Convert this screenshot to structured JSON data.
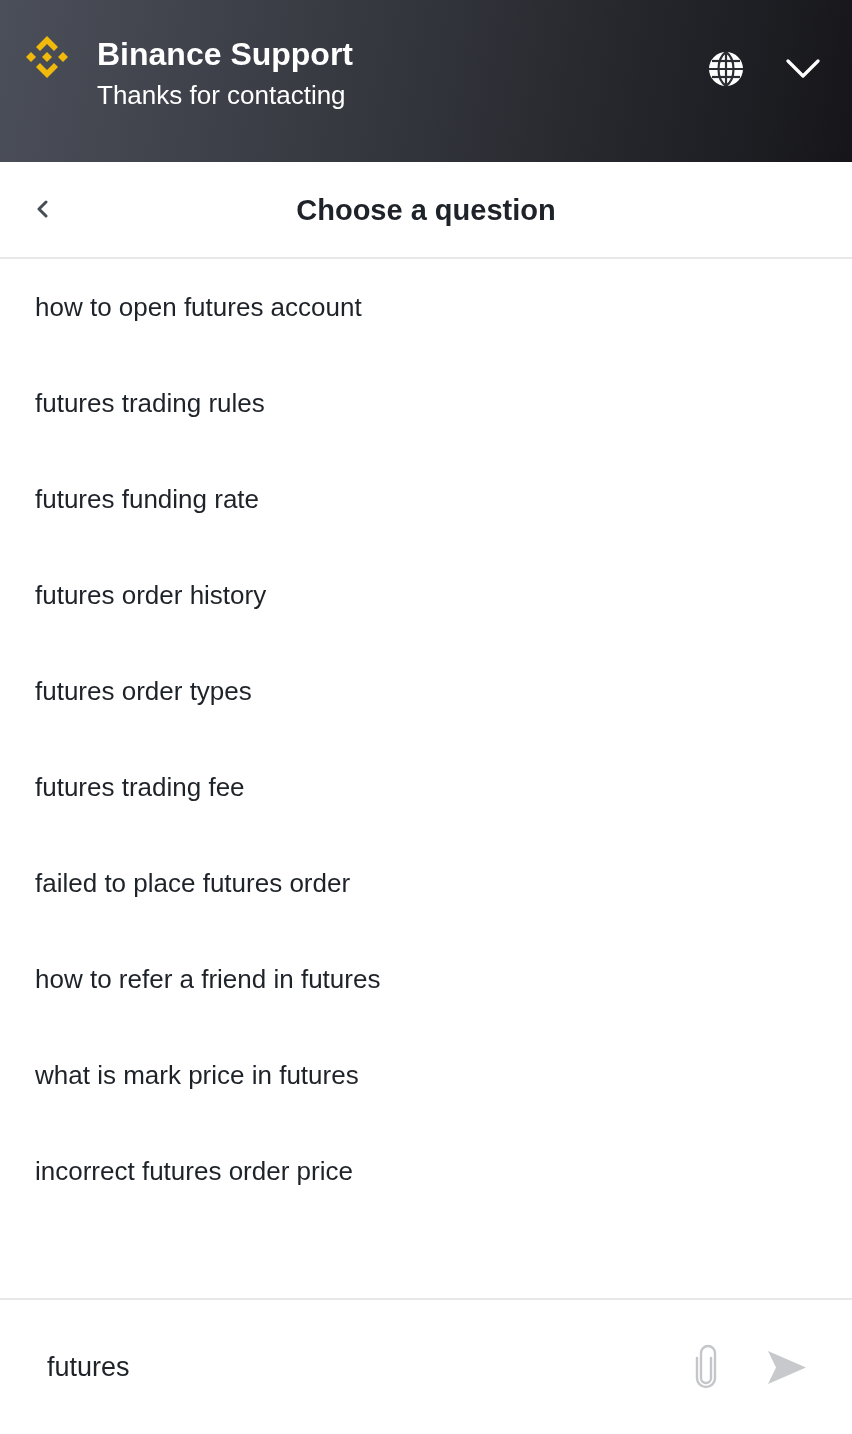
{
  "header": {
    "title": "Binance Support",
    "subtitle": "Thanks for contacting"
  },
  "nav": {
    "title": "Choose a question"
  },
  "questions": [
    "how to open futures account",
    "futures trading rules",
    "futures funding rate",
    "futures order history",
    "futures order types",
    "futures trading fee",
    "failed to place futures order",
    "how to refer a friend in futures",
    "what is mark price in futures",
    "incorrect futures order price"
  ],
  "composer": {
    "value": "futures"
  }
}
